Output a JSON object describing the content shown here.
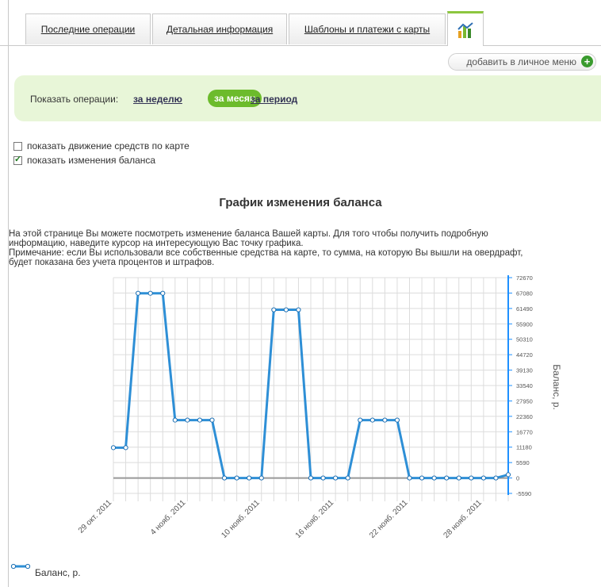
{
  "tabs": [
    {
      "label": "Последние операции"
    },
    {
      "label": "Детальная информация"
    },
    {
      "label": "Шаблоны и платежи с карты"
    }
  ],
  "add_menu_label": "добавить в личное меню",
  "filter": {
    "label": "Показать операции:",
    "week": "за неделю",
    "month": "за месяц",
    "period": "за период"
  },
  "checkboxes": [
    {
      "label": "показать движение средств по карте",
      "checked": false
    },
    {
      "label": "показать изменения баланса",
      "checked": true
    }
  ],
  "chart_title": "График изменения баланса",
  "description": [
    "На этой странице Вы можете посмотреть изменение баланса Вашей карты. Для того чтобы получить подробную",
    "информацию, наведите курсор на интересующую Вас точку графика.",
    "Примечание: если Вы использовали все собственные средства на карте, то сумма, на которую Вы вышли на овердрафт,",
    "будет показана без учета процентов и штрафов."
  ],
  "colors": {
    "accent": "#8cc63f",
    "line": "#2e8fd6",
    "axis": "#1e90ff",
    "filter_bg": "#e8f6d8"
  },
  "chart_data": {
    "type": "line",
    "ylabel": "Баланс, р.",
    "ylim": [
      -5590,
      72670
    ],
    "y_ticks": [
      "72670",
      "67080",
      "61490",
      "55900",
      "50310",
      "44720",
      "39130",
      "33540",
      "27950",
      "22360",
      "16770",
      "11180",
      "5590",
      "0",
      "-5590"
    ],
    "x_ticks": [
      "29 окт. 2011",
      "4 нояб. 2011",
      "10 нояб. 2011",
      "16 нояб. 2011",
      "22 нояб. 2011",
      "28 нояб. 2011"
    ],
    "grid": true,
    "legend": "bottom-left",
    "series": [
      {
        "name": "Баланс, р.",
        "x": [
          "29.10",
          "30.10",
          "31.10",
          "01.11",
          "02.11",
          "03.11",
          "04.11",
          "05.11",
          "06.11",
          "07.11",
          "08.11",
          "09.11",
          "10.11",
          "11.11",
          "12.11",
          "13.11",
          "14.11",
          "15.11",
          "16.11",
          "17.11",
          "18.11",
          "19.11",
          "20.11",
          "21.11",
          "22.11",
          "23.11",
          "24.11",
          "25.11",
          "26.11",
          "27.11",
          "28.11",
          "29.11",
          "30.11"
        ],
        "values": [
          11000,
          11000,
          67000,
          67000,
          67000,
          21000,
          21000,
          21000,
          21000,
          0,
          0,
          0,
          0,
          61000,
          61000,
          61000,
          0,
          0,
          0,
          0,
          21000,
          21000,
          21000,
          21000,
          0,
          0,
          0,
          0,
          0,
          0,
          0,
          0,
          1200
        ]
      }
    ]
  }
}
